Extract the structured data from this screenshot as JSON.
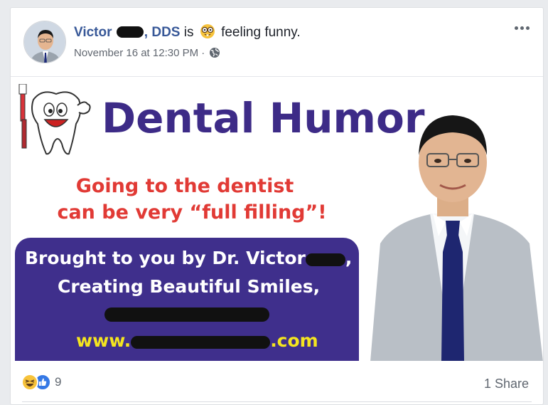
{
  "post": {
    "author": "Victor",
    "author_suffix": ", DDS",
    "is_text": "is",
    "feeling": "feeling funny.",
    "timestamp": "November 16 at 12:30 PM",
    "separator": "·",
    "privacy_icon": "globe-icon",
    "more_icon": "more-options-icon"
  },
  "image": {
    "headline": "Dental Humor",
    "tagline_1": "Going to the dentist",
    "tagline_2": "can be very “full filling”!",
    "promo_1": "Brought to you by Dr. Victor",
    "promo_1_end": ",",
    "promo_2": "Creating Beautiful Smiles,",
    "promo_url_start": "www.",
    "promo_url_end": ".com"
  },
  "footer": {
    "reaction_icons": [
      "haha-icon",
      "like-icon"
    ],
    "reaction_count": "9",
    "share_text": "1 Share"
  },
  "colors": {
    "name_blue": "#385898",
    "headline_purple": "#3d2b87",
    "tagline_red": "#e13a35",
    "promo_bg": "#3f2f8c",
    "url_yellow": "#f4e51f"
  }
}
